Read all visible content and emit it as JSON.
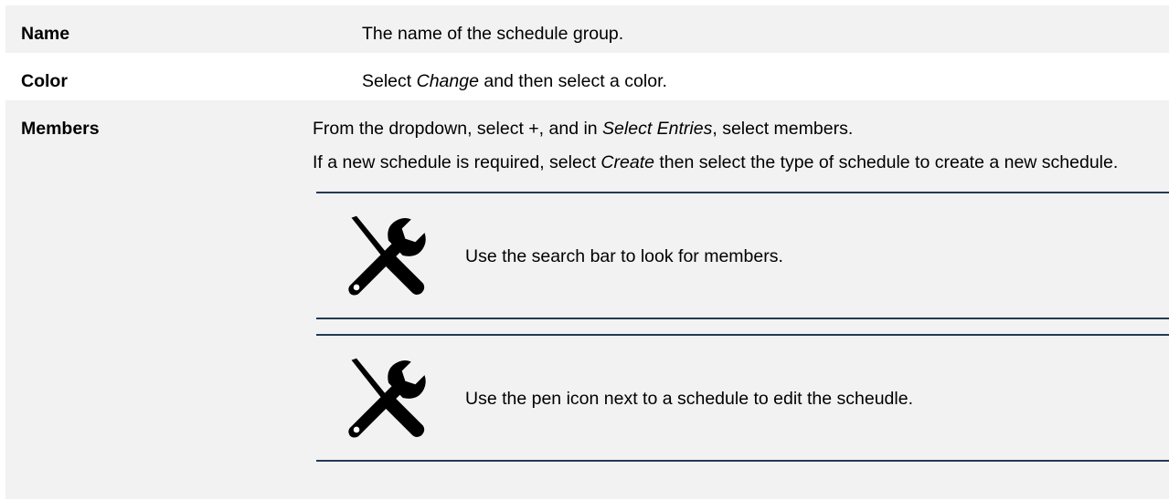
{
  "rows": {
    "name": {
      "label": "Name",
      "text": "The name of the schedule group."
    },
    "color": {
      "label": "Color",
      "text_before": "Select ",
      "text_em": "Change",
      "text_after": " and then select a color."
    },
    "members": {
      "label": "Members",
      "p1_a": "From the dropdown, select +, and in ",
      "p1_em": "Select Entries",
      "p1_b": ", select members.",
      "p2_a": "If a new schedule is required, select ",
      "p2_em": "Create",
      "p2_b": " then select the type of schedule to create a new schedule.",
      "notes": [
        {
          "icon": "tools-icon",
          "text": "Use the search bar to look for members."
        },
        {
          "icon": "tools-icon",
          "text": "Use the pen icon next to a schedule to edit the scheudle."
        }
      ]
    }
  },
  "colors": {
    "row_shade": "#f2f2f2",
    "note_rule": "#243a53",
    "text": "#000000"
  }
}
